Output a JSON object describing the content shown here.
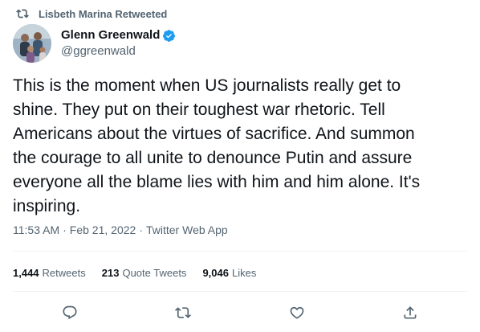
{
  "retweet_context": {
    "label": "Lisbeth Marina Retweeted",
    "icon": "retweet-icon"
  },
  "author": {
    "display_name": "Glenn Greenwald",
    "handle": "@ggreenwald",
    "verified": true,
    "verified_color": "#1d9bf0"
  },
  "tweet": {
    "text": "This is the moment when US journalists really get to\nshine. They put on their toughest war rhetoric. Tell\nAmericans about the virtues of sacrifice. And summon\nthe courage to all unite to denounce Putin and assure\neveryone all the blame lies with him and him alone. It's\ninspiring.",
    "time": "11:53 AM",
    "separator": "·",
    "date": "Feb 21, 2022",
    "source": "Twitter Web App"
  },
  "stats": {
    "retweets_count": "1,444",
    "retweets_label": "Retweets",
    "quotes_count": "213",
    "quotes_label": "Quote Tweets",
    "likes_count": "9,046",
    "likes_label": "Likes"
  },
  "actions": [
    {
      "name": "reply-icon"
    },
    {
      "name": "retweet-icon"
    },
    {
      "name": "like-icon"
    },
    {
      "name": "share-icon"
    }
  ],
  "colors": {
    "text_primary": "#0f1419",
    "text_secondary": "#536471",
    "divider": "#eff3f4",
    "verified": "#1d9bf0"
  }
}
